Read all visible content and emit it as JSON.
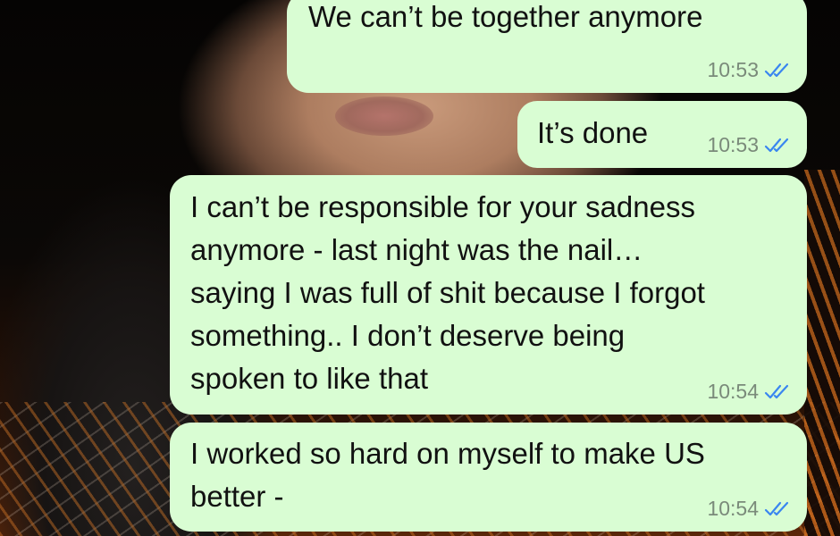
{
  "colors": {
    "bubble_background": "#d9fdd3",
    "read_receipt": "#3a86f0",
    "timestamp": "#7a8a7a"
  },
  "messages": [
    {
      "text": "We can’t be together anymore",
      "time": "10:53",
      "status_icon": "double-check-read-icon"
    },
    {
      "text": "It’s done",
      "time": "10:53",
      "status_icon": "double-check-read-icon"
    },
    {
      "text": "I can’t be responsible for your sadness\nanymore - last night was the nail…\nsaying I was full of shit because I forgot\nsomething.. I don’t deserve being\nspoken to like that",
      "time": "10:54",
      "status_icon": "double-check-read-icon"
    },
    {
      "text": "I worked so hard on myself to make US\nbetter -",
      "time": "10:54",
      "status_icon": "double-check-read-icon"
    }
  ]
}
